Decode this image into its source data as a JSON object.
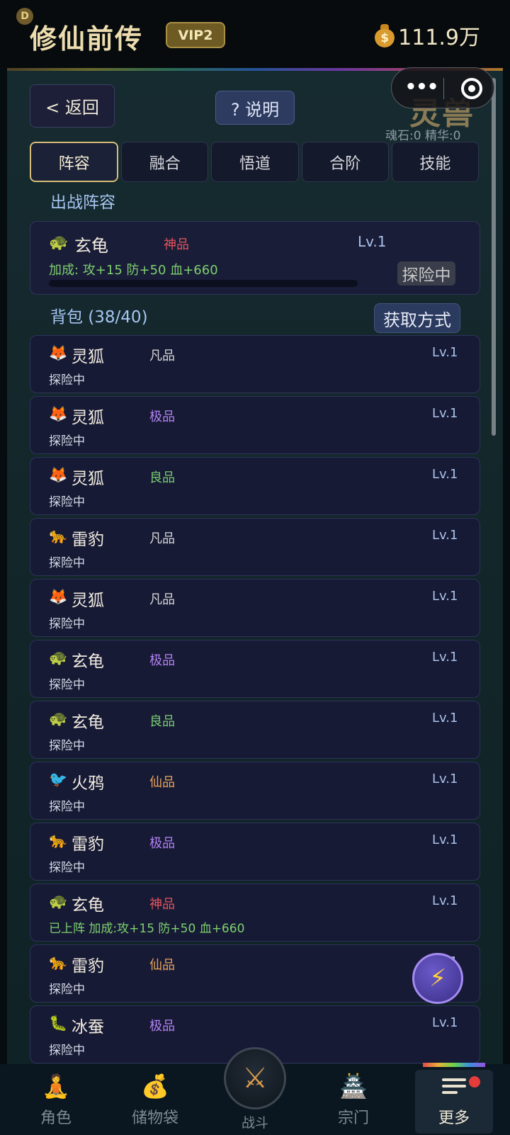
{
  "header": {
    "badge": "D",
    "title": "修仙前传",
    "vip": "VIP2",
    "coins": "111.9万",
    "coin_icon": "money-bag-icon"
  },
  "toolbar": {
    "back_label": "< 返回",
    "help_label": "? 说明",
    "page_title": "灵兽",
    "resources": "魂石:0 精华:0",
    "more_dots": "•••"
  },
  "tabs": [
    "阵容",
    "融合",
    "悟道",
    "合阶",
    "技能"
  ],
  "active_tab": 0,
  "formation": {
    "section_title": "出战阵容",
    "card": {
      "icon": "🐢",
      "name": "玄龟",
      "rarity": "神品",
      "level": "Lv.1",
      "bonus": "加成: 攻+15 防+50 血+660",
      "status": "探险中"
    }
  },
  "bag": {
    "section_title": "背包 (38/40)",
    "obtain_label": "获取方式",
    "items": [
      {
        "icon": "🦊",
        "name": "灵狐",
        "rarity": "凡品",
        "rarity_class": "r-fan",
        "level": "Lv.1",
        "status": "探险中"
      },
      {
        "icon": "🦊",
        "name": "灵狐",
        "rarity": "极品",
        "rarity_class": "r-ji",
        "level": "Lv.1",
        "status": "探险中"
      },
      {
        "icon": "🦊",
        "name": "灵狐",
        "rarity": "良品",
        "rarity_class": "r-liang",
        "level": "Lv.1",
        "status": "探险中"
      },
      {
        "icon": "🐆",
        "name": "雷豹",
        "rarity": "凡品",
        "rarity_class": "r-fan",
        "level": "Lv.1",
        "status": "探险中"
      },
      {
        "icon": "🦊",
        "name": "灵狐",
        "rarity": "凡品",
        "rarity_class": "r-fan",
        "level": "Lv.1",
        "status": "探险中"
      },
      {
        "icon": "🐢",
        "name": "玄龟",
        "rarity": "极品",
        "rarity_class": "r-ji",
        "level": "Lv.1",
        "status": "探险中"
      },
      {
        "icon": "🐢",
        "name": "玄龟",
        "rarity": "良品",
        "rarity_class": "r-liang",
        "level": "Lv.1",
        "status": "探险中"
      },
      {
        "icon": "🐦",
        "name": "火鸦",
        "rarity": "仙品",
        "rarity_class": "r-xian",
        "level": "Lv.1",
        "status": "探险中"
      },
      {
        "icon": "🐆",
        "name": "雷豹",
        "rarity": "极品",
        "rarity_class": "r-ji",
        "level": "Lv.1",
        "status": "探险中"
      },
      {
        "icon": "🐢",
        "name": "玄龟",
        "rarity": "神品",
        "rarity_class": "r-shen",
        "level": "Lv.1",
        "status": "已上阵 加成:攻+15 防+50 血+660",
        "status_green": true
      },
      {
        "icon": "🐆",
        "name": "雷豹",
        "rarity": "仙品",
        "rarity_class": "r-xian",
        "level": "Lv.1",
        "status": "探险中"
      },
      {
        "icon": "🐛",
        "name": "冰蚕",
        "rarity": "极品",
        "rarity_class": "r-ji",
        "level": "Lv.1",
        "status": "探险中"
      }
    ]
  },
  "fab": {
    "icon": "lightning-icon",
    "glyph": "⚡"
  },
  "nav": {
    "items": [
      {
        "label": "角色",
        "icon": "meditating-figure-icon",
        "glyph": "🧘"
      },
      {
        "label": "储物袋",
        "icon": "storage-bag-icon",
        "glyph": "💰"
      },
      {
        "label": "宗门",
        "icon": "temple-icon",
        "glyph": "🏯"
      },
      {
        "label": "更多",
        "icon": "menu-icon",
        "glyph": ""
      }
    ],
    "battle_label": "战斗",
    "battle_icon": "crossed-swords-icon",
    "battle_glyph": "⚔"
  },
  "colors": {
    "accent_gold": "#d6bd79",
    "rarity_fan": "#d8d8d8",
    "rarity_liang": "#79cf72",
    "rarity_ji": "#b382f5",
    "rarity_xian": "#e9a35c",
    "rarity_shen": "#e5545e"
  }
}
